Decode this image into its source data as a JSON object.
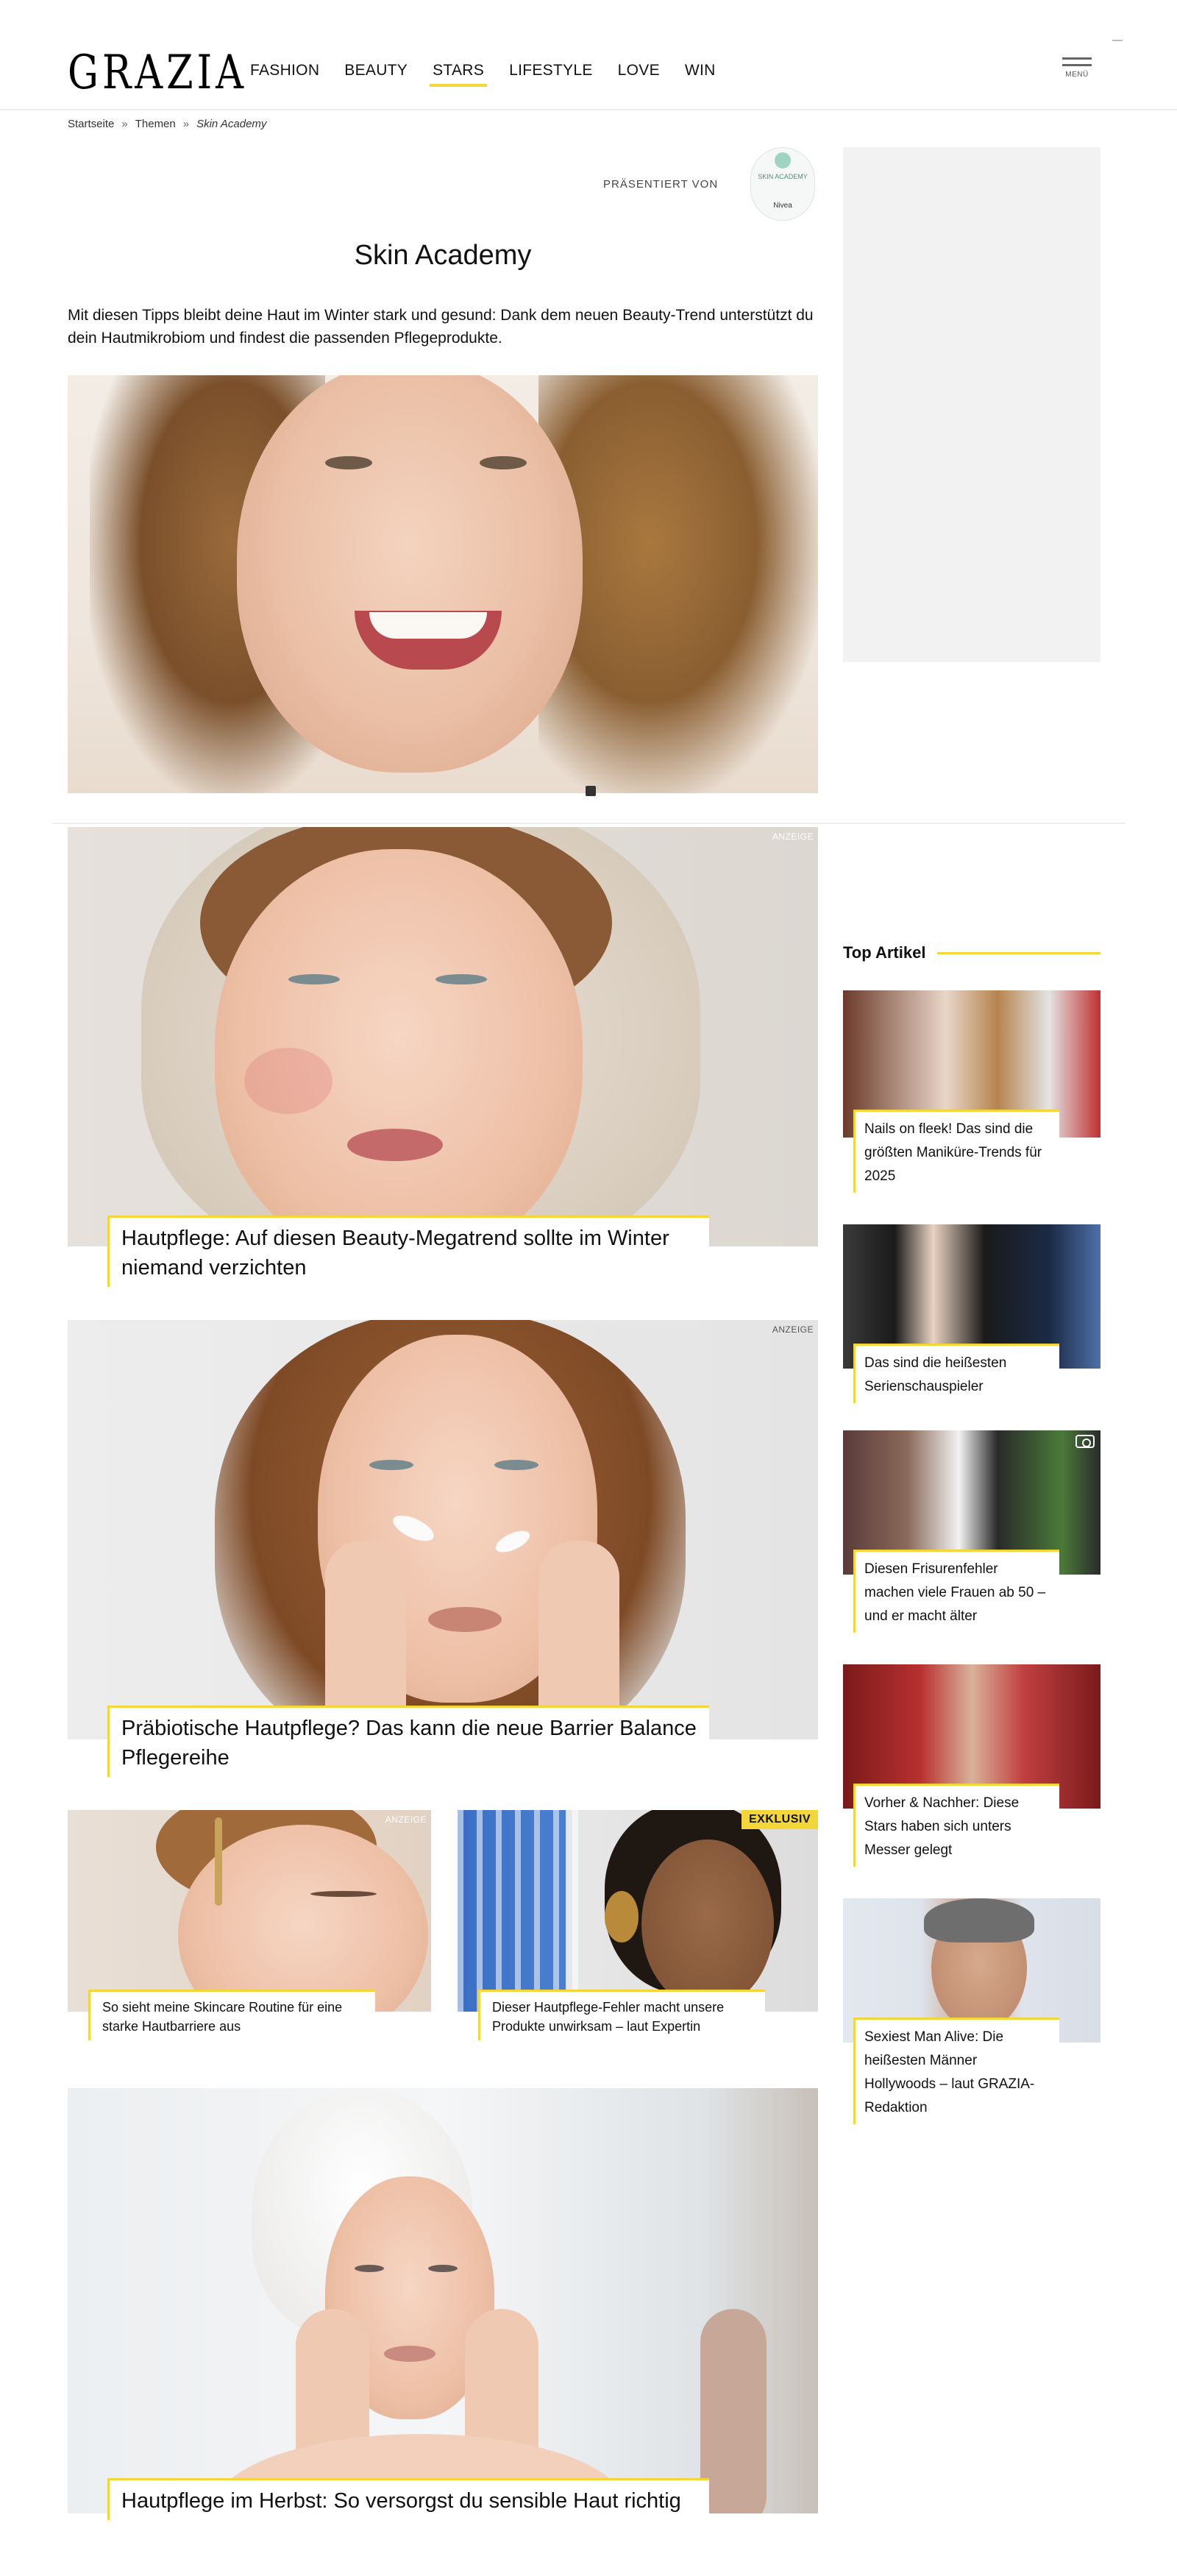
{
  "header": {
    "logo": "GRAZIA",
    "nav": [
      "FASHION",
      "BEAUTY",
      "STARS",
      "LIFESTYLE",
      "LOVE",
      "WIN"
    ],
    "active_nav": "STARS",
    "menu_label": "MENÜ"
  },
  "breadcrumb": {
    "items": [
      "Startseite",
      "Themen"
    ],
    "current": "Skin Academy"
  },
  "sponsor": {
    "label": "PRÄSENTIERT VON",
    "logo_text": "SKIN ACADEMY",
    "logo_bottom": "Nivea"
  },
  "hero": {
    "title": "Skin Academy",
    "intro": "Mit diesen Tipps bleibt deine Haut im Winter stark und gesund: Dank dem neuen Beauty-Trend unterstützt du dein Hautmikrobiom und findest die passenden Pflegeprodukte."
  },
  "articles": [
    {
      "title": "Hautpflege: Auf diesen Beauty-Megatrend solltest du im Winter niemand verzichten",
      "display_title": "Hautpflege: Auf diesen Beauty-Megatrend sollte im Winter niemand verzichten",
      "label": "ANZEIGE"
    },
    {
      "display_title": "Präbiotische Hautpflege? Das kann die neue Barrier Balance Pflegereihe",
      "label": "ANZEIGE"
    },
    {
      "display_title": "So sieht meine Skincare Routine für eine starke Hautbarriere aus",
      "label": "ANZEIGE"
    },
    {
      "display_title": "Dieser Hautpflege-Fehler macht unsere Produkte unwirksam – laut Expertin",
      "badge": "EXKLUSIV"
    },
    {
      "display_title": "Hautpflege im Herbst: So versorgst du sensible Haut richtig"
    }
  ],
  "sidebar": {
    "top_heading": "Top Artikel",
    "top_articles": [
      {
        "title": "Nails on fleek! Das sind die größten Maniküre-Trends für 2025"
      },
      {
        "title": "Das sind die heißesten Serienschauspieler"
      },
      {
        "title": "Diesen Frisurenfehler machen viele Frauen ab 50 – und er macht älter"
      },
      {
        "title": "Vorher & Nachher: Diese Stars haben sich unters Messer gelegt"
      },
      {
        "title": "Sexiest Man Alive: Die heißesten Männer Hollywoods – laut GRAZIA-Redaktion"
      }
    ]
  },
  "colors": {
    "accent": "#f2d63a",
    "ad_placeholder": "#f2f2f2"
  }
}
